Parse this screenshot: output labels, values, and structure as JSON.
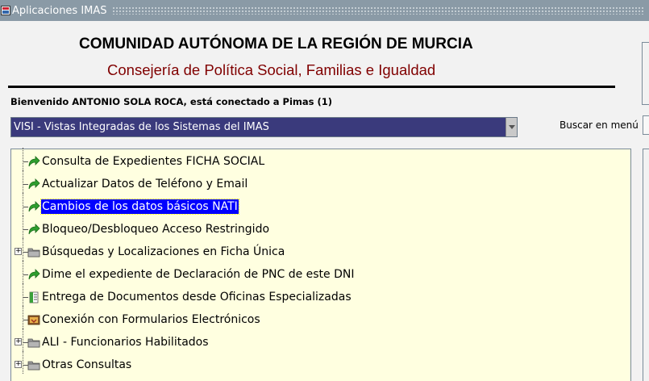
{
  "window": {
    "title": "Aplicaciones IMAS"
  },
  "header": {
    "title": "COMUNIDAD AUTÓNOMA DE LA REGIÓN DE MURCIA",
    "subtitle": "Consejería de Política Social, Familias e Igualdad"
  },
  "welcome": "Bienvenido ANTONIO SOLA ROCA, está conectado a Pimas (1)",
  "app_select": {
    "value": "VISI - Vistas Integradas de los Sistemas del IMAS"
  },
  "search": {
    "label": "Buscar en menú",
    "value": ""
  },
  "colors": {
    "selected_bg": "#0000ff",
    "tree_bg": "#ffffe0",
    "subtitle": "#800000",
    "select_bg": "#3a3a7c"
  },
  "tree": {
    "items": [
      {
        "label": "Consulta de Expedientes FICHA SOCIAL",
        "icon": "green-arrow-icon",
        "expandable": false,
        "selected": false
      },
      {
        "label": "Actualizar Datos de Teléfono y Email",
        "icon": "green-arrow-icon",
        "expandable": false,
        "selected": false
      },
      {
        "label": "Cambios de los datos básicos NATI",
        "icon": "green-arrow-icon",
        "expandable": false,
        "selected": true
      },
      {
        "label": "Bloqueo/Desbloqueo Acceso Restringido",
        "icon": "green-arrow-icon",
        "expandable": false,
        "selected": false
      },
      {
        "label": "Búsquedas y Localizaciones en Ficha Única",
        "icon": "folder-icon",
        "expandable": true,
        "selected": false
      },
      {
        "label": "Dime el expediente de Declaración de PNC de este DNI",
        "icon": "green-arrow-icon",
        "expandable": false,
        "selected": false
      },
      {
        "label": "Entrega de Documentos desde Oficinas Especializadas",
        "icon": "document-icon",
        "expandable": false,
        "selected": false
      },
      {
        "label": "Conexión con Formularios Electrónicos",
        "icon": "form-icon",
        "expandable": false,
        "selected": false
      },
      {
        "label": "ALI - Funcionarios Habilitados",
        "icon": "folder-icon",
        "expandable": true,
        "selected": false
      },
      {
        "label": "Otras Consultas",
        "icon": "folder-icon",
        "expandable": true,
        "selected": false
      }
    ]
  }
}
